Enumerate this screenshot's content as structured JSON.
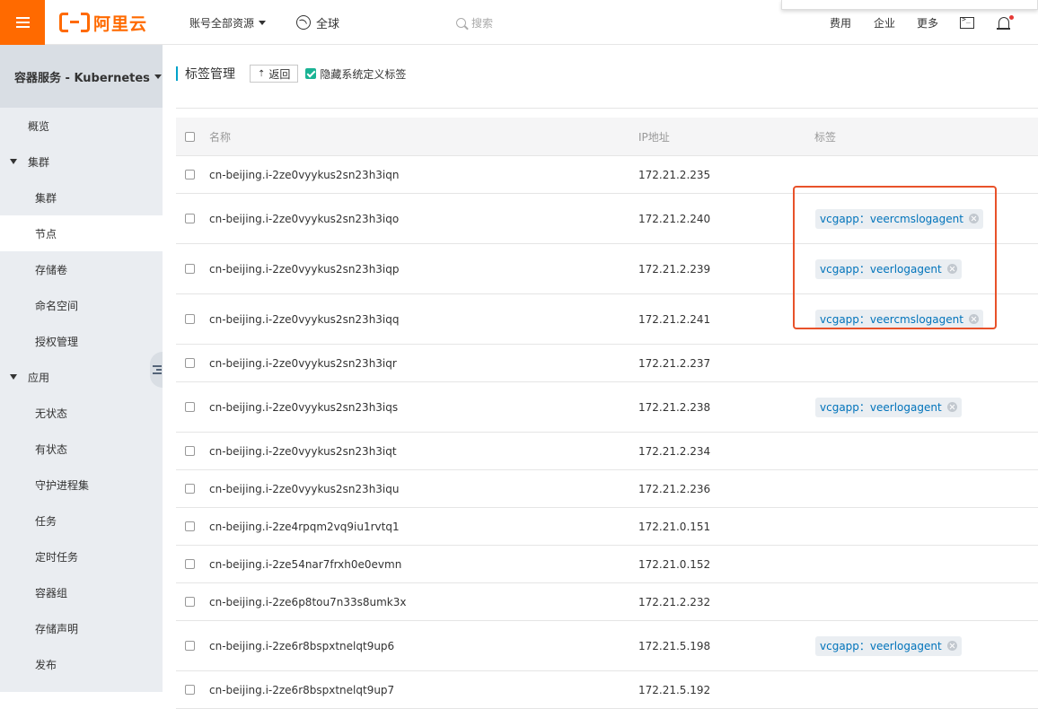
{
  "topbar": {
    "logo_text": "阿里云",
    "account_scope": "账号全部资源",
    "region": "全球",
    "search_placeholder": "搜索",
    "links": [
      "费用",
      "企业",
      "更多"
    ],
    "brand_color": "#ff6a00"
  },
  "sidebar": {
    "header": "容器服务 - Kubernetes",
    "overview": "概览",
    "group_cluster": "集群",
    "cluster_items": [
      "集群",
      "节点",
      "存储卷",
      "命名空间",
      "授权管理"
    ],
    "group_app": "应用",
    "app_items": [
      "无状态",
      "有状态",
      "守护进程集",
      "任务",
      "定时任务",
      "容器组",
      "存储声明",
      "发布"
    ],
    "active_item": "节点"
  },
  "main": {
    "title": "标签管理",
    "back_label": "返回",
    "hide_system_label": "隐藏系统定义标签",
    "hide_system_checked": true,
    "columns": [
      "名称",
      "IP地址",
      "标签"
    ],
    "rows": [
      {
        "name": "cn-beijing.i-2ze0vyykus2sn23h3iqn",
        "ip": "172.21.2.235",
        "tag": ""
      },
      {
        "name": "cn-beijing.i-2ze0vyykus2sn23h3iqo",
        "ip": "172.21.2.240",
        "tag": "vcgapp：veercmslogagent"
      },
      {
        "name": "cn-beijing.i-2ze0vyykus2sn23h3iqp",
        "ip": "172.21.2.239",
        "tag": "vcgapp：veerlogagent"
      },
      {
        "name": "cn-beijing.i-2ze0vyykus2sn23h3iqq",
        "ip": "172.21.2.241",
        "tag": "vcgapp：veercmslogagent"
      },
      {
        "name": "cn-beijing.i-2ze0vyykus2sn23h3iqr",
        "ip": "172.21.2.237",
        "tag": ""
      },
      {
        "name": "cn-beijing.i-2ze0vyykus2sn23h3iqs",
        "ip": "172.21.2.238",
        "tag": "vcgapp：veerlogagent"
      },
      {
        "name": "cn-beijing.i-2ze0vyykus2sn23h3iqt",
        "ip": "172.21.2.234",
        "tag": ""
      },
      {
        "name": "cn-beijing.i-2ze0vyykus2sn23h3iqu",
        "ip": "172.21.2.236",
        "tag": ""
      },
      {
        "name": "cn-beijing.i-2ze4rpqm2vq9iu1rvtq1",
        "ip": "172.21.0.151",
        "tag": ""
      },
      {
        "name": "cn-beijing.i-2ze54nar7frxh0e0evmn",
        "ip": "172.21.0.152",
        "tag": ""
      },
      {
        "name": "cn-beijing.i-2ze6p8tou7n33s8umk3x",
        "ip": "172.21.2.232",
        "tag": ""
      },
      {
        "name": "cn-beijing.i-2ze6r8bspxtnelqt9up6",
        "ip": "172.21.5.198",
        "tag": "vcgapp：veerlogagent"
      },
      {
        "name": "cn-beijing.i-2ze6r8bspxtnelqt9up7",
        "ip": "172.21.5.192",
        "tag": ""
      }
    ],
    "highlight_color": "#e8522a"
  }
}
